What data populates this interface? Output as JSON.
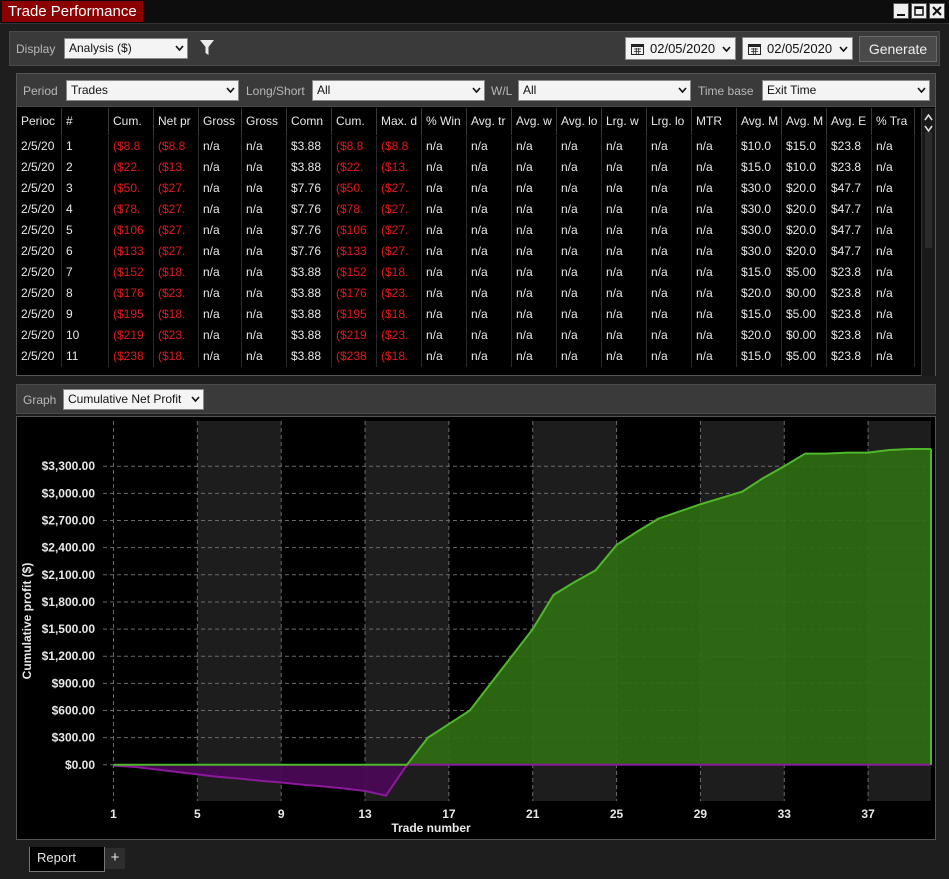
{
  "window": {
    "title": "Trade Performance"
  },
  "toolbar": {
    "display_label": "Display",
    "display_value": "Analysis ($)",
    "date_from": "02/05/2020",
    "date_to": "02/05/2020",
    "generate_label": "Generate"
  },
  "filters": {
    "period_label": "Period",
    "period_value": "Trades",
    "longshort_label": "Long/Short",
    "longshort_value": "All",
    "wl_label": "W/L",
    "wl_value": "All",
    "timebase_label": "Time base",
    "timebase_value": "Exit Time"
  },
  "table": {
    "columns": [
      "Perioc",
      "#",
      "Cum.",
      "Net pr",
      "Gross",
      "Gross",
      "Comn",
      "Cum.",
      "Max. d",
      "% Win",
      "Avg. tr",
      "Avg. w",
      "Avg. lo",
      "Lrg. w",
      "Lrg. lo",
      "MTR",
      "Avg. M",
      "Avg. M",
      "Avg. E",
      "% Tra"
    ],
    "rows": [
      [
        "2/5/20",
        "1",
        "($8.8",
        "($8.8",
        "n/a",
        "n/a",
        "$3.88",
        "($8.8",
        "($8.8",
        "n/a",
        "n/a",
        "n/a",
        "n/a",
        "n/a",
        "n/a",
        "n/a",
        "$10.0",
        "$15.0",
        "$23.8",
        "n/a"
      ],
      [
        "2/5/20",
        "2",
        "($22.",
        "($13.",
        "n/a",
        "n/a",
        "$3.88",
        "($22.",
        "($13.",
        "n/a",
        "n/a",
        "n/a",
        "n/a",
        "n/a",
        "n/a",
        "n/a",
        "$15.0",
        "$10.0",
        "$23.8",
        "n/a"
      ],
      [
        "2/5/20",
        "3",
        "($50.",
        "($27.",
        "n/a",
        "n/a",
        "$7.76",
        "($50.",
        "($27.",
        "n/a",
        "n/a",
        "n/a",
        "n/a",
        "n/a",
        "n/a",
        "n/a",
        "$30.0",
        "$20.0",
        "$47.7",
        "n/a"
      ],
      [
        "2/5/20",
        "4",
        "($78.",
        "($27.",
        "n/a",
        "n/a",
        "$7.76",
        "($78.",
        "($27.",
        "n/a",
        "n/a",
        "n/a",
        "n/a",
        "n/a",
        "n/a",
        "n/a",
        "$30.0",
        "$20.0",
        "$47.7",
        "n/a"
      ],
      [
        "2/5/20",
        "5",
        "($106",
        "($27.",
        "n/a",
        "n/a",
        "$7.76",
        "($106",
        "($27.",
        "n/a",
        "n/a",
        "n/a",
        "n/a",
        "n/a",
        "n/a",
        "n/a",
        "$30.0",
        "$20.0",
        "$47.7",
        "n/a"
      ],
      [
        "2/5/20",
        "6",
        "($133",
        "($27.",
        "n/a",
        "n/a",
        "$7.76",
        "($133",
        "($27.",
        "n/a",
        "n/a",
        "n/a",
        "n/a",
        "n/a",
        "n/a",
        "n/a",
        "$30.0",
        "$20.0",
        "$47.7",
        "n/a"
      ],
      [
        "2/5/20",
        "7",
        "($152",
        "($18.",
        "n/a",
        "n/a",
        "$3.88",
        "($152",
        "($18.",
        "n/a",
        "n/a",
        "n/a",
        "n/a",
        "n/a",
        "n/a",
        "n/a",
        "$15.0",
        "$5.00",
        "$23.8",
        "n/a"
      ],
      [
        "2/5/20",
        "8",
        "($176",
        "($23.",
        "n/a",
        "n/a",
        "$3.88",
        "($176",
        "($23.",
        "n/a",
        "n/a",
        "n/a",
        "n/a",
        "n/a",
        "n/a",
        "n/a",
        "$20.0",
        "$0.00",
        "$23.8",
        "n/a"
      ],
      [
        "2/5/20",
        "9",
        "($195",
        "($18.",
        "n/a",
        "n/a",
        "$3.88",
        "($195",
        "($18.",
        "n/a",
        "n/a",
        "n/a",
        "n/a",
        "n/a",
        "n/a",
        "n/a",
        "$15.0",
        "$5.00",
        "$23.8",
        "n/a"
      ],
      [
        "2/5/20",
        "10",
        "($219",
        "($23.",
        "n/a",
        "n/a",
        "$3.88",
        "($219",
        "($23.",
        "n/a",
        "n/a",
        "n/a",
        "n/a",
        "n/a",
        "n/a",
        "n/a",
        "$20.0",
        "$0.00",
        "$23.8",
        "n/a"
      ],
      [
        "2/5/20",
        "11",
        "($238",
        "($18.",
        "n/a",
        "n/a",
        "$3.88",
        "($238",
        "($18.",
        "n/a",
        "n/a",
        "n/a",
        "n/a",
        "n/a",
        "n/a",
        "n/a",
        "$15.0",
        "$5.00",
        "$23.8",
        "n/a"
      ]
    ],
    "negative_columns": [
      2,
      3,
      7,
      8
    ]
  },
  "graph": {
    "label": "Graph",
    "value": "Cumulative Net Profit"
  },
  "chart_data": {
    "type": "area",
    "xlabel": "Trade number",
    "ylabel": "Cumulative profit ($)",
    "xlim": [
      0.5,
      40
    ],
    "ylim": [
      -400,
      3800
    ],
    "x_ticks": [
      1,
      5,
      9,
      13,
      17,
      21,
      25,
      29,
      33,
      37
    ],
    "y_ticks": [
      0,
      300,
      600,
      900,
      1200,
      1500,
      1800,
      2100,
      2400,
      2700,
      3000,
      3300
    ],
    "y_tick_labels": [
      "$0.00",
      "$300.00",
      "$600.00",
      "$900.00",
      "$1,200.00",
      "$1,500.00",
      "$1,800.00",
      "$2,100.00",
      "$2,400.00",
      "$2,700.00",
      "$3,000.00",
      "$3,300.00"
    ],
    "grid": true,
    "series": [
      {
        "x": [
          1,
          2,
          3,
          4,
          5,
          6,
          7,
          8,
          9,
          10,
          11,
          12,
          13,
          14,
          15,
          16,
          17,
          18,
          19,
          20,
          21,
          22,
          23,
          24,
          25,
          26,
          27,
          28,
          29,
          30,
          31,
          32,
          33,
          34,
          35,
          36,
          37,
          38,
          39,
          40
        ],
        "y": [
          -9,
          -23,
          -51,
          -78,
          -106,
          -133,
          -152,
          -176,
          -195,
          -219,
          -238,
          -262,
          -290,
          -340,
          0,
          300,
          450,
          600,
          900,
          1200,
          1500,
          1880,
          2020,
          2150,
          2430,
          2580,
          2720,
          2800,
          2880,
          2950,
          3020,
          3170,
          3300,
          3440,
          3440,
          3450,
          3450,
          3480,
          3490,
          3490
        ],
        "positive_color": "#4fb82a",
        "negative_color": "#8a1a9a"
      }
    ]
  }
}
